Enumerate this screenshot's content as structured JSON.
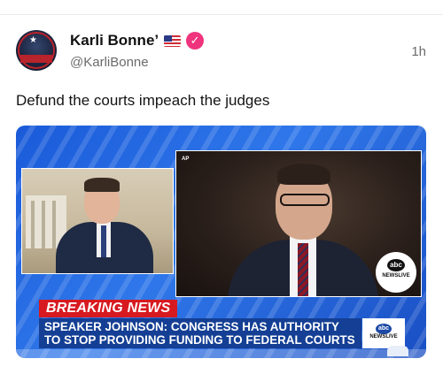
{
  "post": {
    "display_name": "Karli Bonne’",
    "flag_icon": "us-flag-icon",
    "verified_icon": "verified-badge-icon",
    "handle": "@KarliBonne",
    "time": "1h",
    "text": "Defund the courts impeach the judges",
    "avatar_text": "Midnight Rider"
  },
  "media": {
    "source_tag": "AP",
    "breaking": "BREAKING NEWS",
    "headline": "SPEAKER JOHNSON: CONGRESS HAS AUTHORITY TO STOP PROVIDING FUNDING TO FEDERAL COURTS",
    "network_small": "abc",
    "network_label": "NEWSLIVE",
    "colors": {
      "banner_red": "#d71920",
      "banner_blue": "#143f94",
      "badge_pink": "#f0337d"
    }
  }
}
